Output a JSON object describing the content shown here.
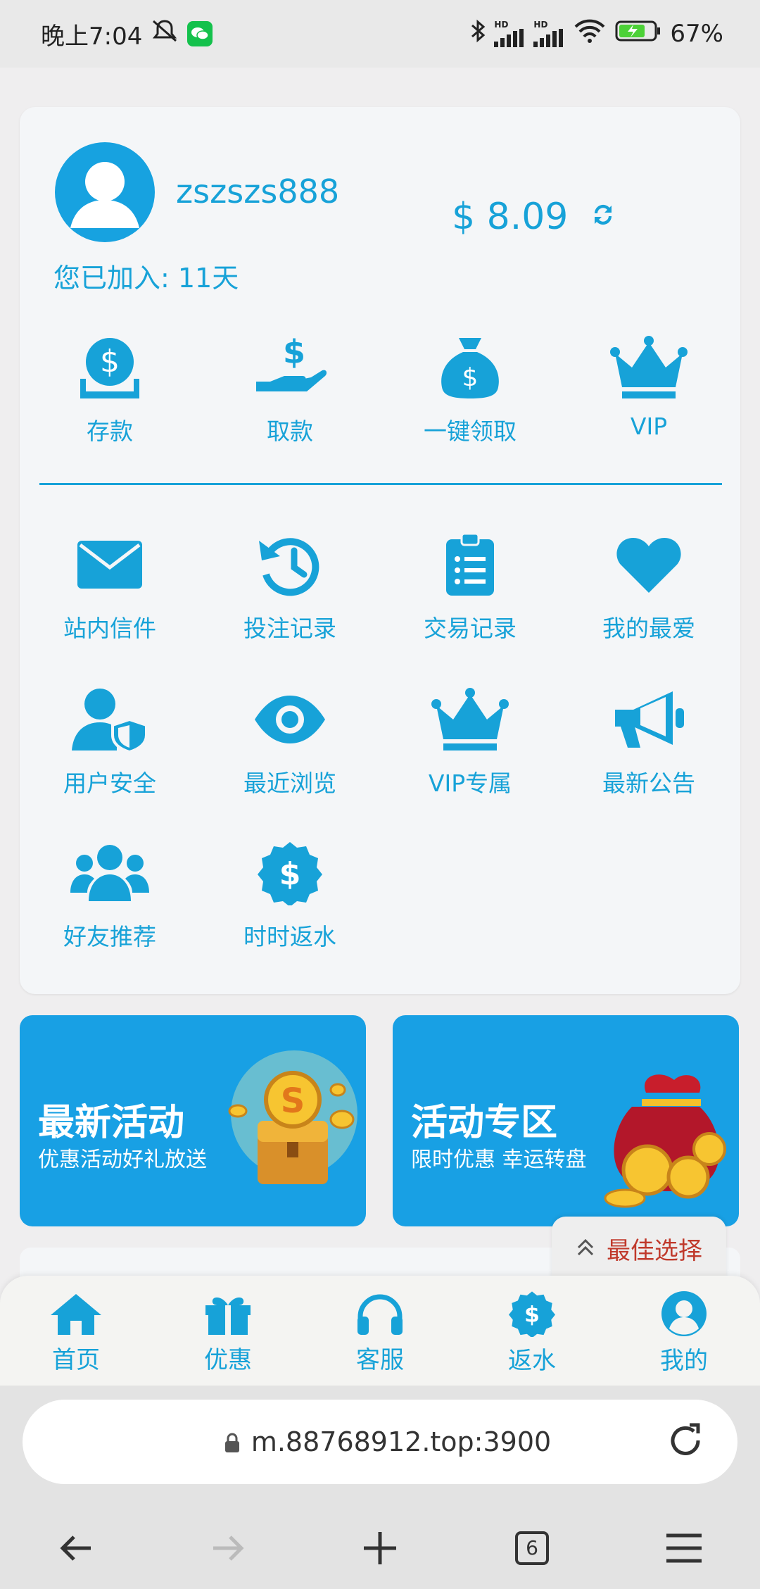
{
  "status_bar": {
    "time": "晚上7:04",
    "battery": "67%",
    "net1": "HD",
    "net2": "HD"
  },
  "profile": {
    "username": "zszszs888",
    "joined": "您已加入: 11天",
    "balance": "$ 8.09"
  },
  "quick_actions": [
    {
      "label": "存款",
      "icon": "deposit-icon"
    },
    {
      "label": "取款",
      "icon": "withdraw-icon"
    },
    {
      "label": "一键领取",
      "icon": "money-bag-icon"
    },
    {
      "label": "VIP",
      "icon": "crown-icon"
    }
  ],
  "menu": [
    {
      "label": "站内信件",
      "icon": "mail-icon"
    },
    {
      "label": "投注记录",
      "icon": "history-icon"
    },
    {
      "label": "交易记录",
      "icon": "clipboard-icon"
    },
    {
      "label": "我的最爱",
      "icon": "heart-icon"
    },
    {
      "label": "用户安全",
      "icon": "user-shield-icon"
    },
    {
      "label": "最近浏览",
      "icon": "eye-icon"
    },
    {
      "label": "VIP专属",
      "icon": "crown-icon"
    },
    {
      "label": "最新公告",
      "icon": "megaphone-icon"
    },
    {
      "label": "好友推荐",
      "icon": "users-icon"
    },
    {
      "label": "时时返水",
      "icon": "dollar-badge-icon"
    }
  ],
  "banners": [
    {
      "title": "最新活动",
      "subtitle": "优惠活动好礼放送"
    },
    {
      "title": "活动专区",
      "subtitle": "限时优惠 幸运转盘"
    }
  ],
  "best_choice": "最佳选择",
  "tabs": [
    {
      "label": "首页",
      "icon": "home-icon"
    },
    {
      "label": "优惠",
      "icon": "gift-icon"
    },
    {
      "label": "客服",
      "icon": "headphones-icon"
    },
    {
      "label": "返水",
      "icon": "dollar-badge-icon"
    },
    {
      "label": "我的",
      "icon": "user-circle-icon"
    }
  ],
  "browser": {
    "url": "m.88768912.top:3900",
    "tab_count": "6"
  },
  "colors": {
    "accent": "#17a2d8",
    "banner": "#18a0e4",
    "best_text": "#c0392b"
  }
}
